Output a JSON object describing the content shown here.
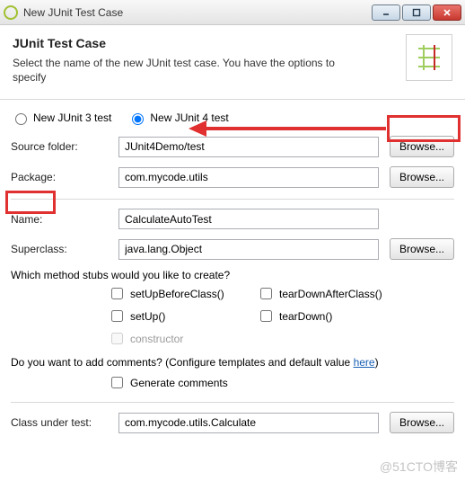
{
  "titlebar": {
    "title": "New JUnit Test Case"
  },
  "header": {
    "heading": "JUnit Test Case",
    "desc": "Select the name of the new JUnit test case. You have the options to specify"
  },
  "radios": {
    "junit3": "New JUnit 3 test",
    "junit4": "New JUnit 4 test"
  },
  "fields": {
    "sourceFolderLabel": "Source folder:",
    "sourceFolderValue": "JUnit4Demo/test",
    "packageLabel": "Package:",
    "packageValue": "com.mycode.utils",
    "nameLabel": "Name:",
    "nameValue": "CalculateAutoTest",
    "superclassLabel": "Superclass:",
    "superclassValue": "java.lang.Object",
    "classUnderTestLabel": "Class under test:",
    "classUnderTestValue": "com.mycode.utils.Calculate"
  },
  "buttons": {
    "browse": "Browse..."
  },
  "stubs": {
    "question": "Which method stubs would you like to create?",
    "setUpBeforeClass": "setUpBeforeClass()",
    "tearDownAfterClass": "tearDownAfterClass()",
    "setUp": "setUp()",
    "tearDown": "tearDown()",
    "constructor": "constructor"
  },
  "comments": {
    "question_a": "Do you want to add comments? (Configure templates and default value ",
    "here": "here",
    "question_b": ")",
    "generate": "Generate comments"
  },
  "watermark": "@51CTO博客"
}
